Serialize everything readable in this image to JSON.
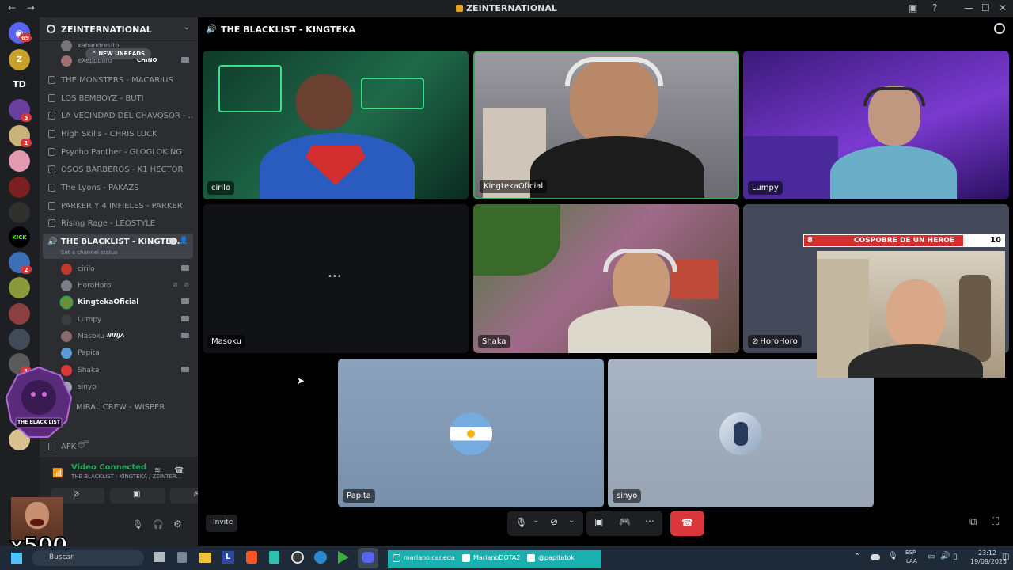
{
  "window": {
    "title": "ZEINTERNATIONAL"
  },
  "rail": {
    "home_badge": "69",
    "td_label": "TD",
    "kick_label": "KICK",
    "badges": [
      "5",
      "1",
      "2",
      "1"
    ]
  },
  "server": {
    "name": "ZEINTERNATIONAL",
    "new_unreads": "NEW UNREADS",
    "partial_top_1": "xabandresito",
    "partial_top_2": "eXeppbard",
    "partial_top_2_tag": "CHINO",
    "channels": [
      "THE MONSTERS - MACARIUS",
      "LOS BEMBOYZ - BUTI",
      "LA VECINDAD DEL CHAVOSOR - ...",
      "High Skills - CHRIS LUCK",
      "Psycho Panther - GLOGLOKING",
      "OSOS BARBEROS - K1 HECTOR",
      "The Lyons - PAKAZS",
      "PARKER Y 4 INFIELES - PARKER",
      "Rising Rage - LEOSTYLE"
    ],
    "active_channel": "THE BLACKLIST - KINGTE...",
    "active_channel_status": "Set a channel status",
    "members": [
      {
        "name": "cirilo",
        "color": "#c0392b",
        "bold": false
      },
      {
        "name": "HoroHoro",
        "color": "#7a7f8c",
        "bold": false
      },
      {
        "name": "KingtekaOficial",
        "color": "#6a8e3a",
        "bold": true
      },
      {
        "name": "Lumpy",
        "color": "#2b2d31",
        "bold": false
      },
      {
        "name": "Masoku",
        "color": "#8a6a6a",
        "bold": false
      },
      {
        "name": "Papita",
        "color": "#5b9bd5",
        "bold": false
      },
      {
        "name": "Shaka",
        "color": "#da373c",
        "bold": false
      },
      {
        "name": "sinyo",
        "color": "#9aa5b1",
        "bold": false
      }
    ],
    "masoku_tag": "NINJA",
    "after_channel": "MIRAL CREW - WISPER",
    "afk_channel": "AFK"
  },
  "voice": {
    "status": "Video Connected",
    "channel": "THE BLACKLIST - KINGTEKA / ZEINTER..."
  },
  "overlay": {
    "streamer_logo": "THE BLACK LIST",
    "multiplier": "x500"
  },
  "main": {
    "channel_title": "THE BLACKLIST - KINGTEKA",
    "tiles": [
      {
        "name": "cirilo"
      },
      {
        "name": "KingtekaOficial"
      },
      {
        "name": "Lumpy"
      },
      {
        "name": "Masoku"
      },
      {
        "name": "Shaka"
      },
      {
        "name": "HoroHoro"
      },
      {
        "name": "Papita"
      },
      {
        "name": "sinyo"
      }
    ],
    "invite": "Invite",
    "more_dots": "•••"
  },
  "scoreboard": {
    "left_score": "8",
    "title": "COSPOBRE DE UN HEROE",
    "right_score": "10"
  },
  "taskbar": {
    "search_placeholder": "Buscar",
    "social_1": "mariano.caneda",
    "social_2": "MarianoDOTA2",
    "social_3": "@papitatok",
    "lang_1": "ESP",
    "lang_2": "LAA",
    "time": "23:12",
    "date": "19/09/2025"
  },
  "colors": {
    "accent_green": "#23a55a",
    "hangup_red": "#da373c",
    "scoreboard_red": "#d32f2f"
  }
}
